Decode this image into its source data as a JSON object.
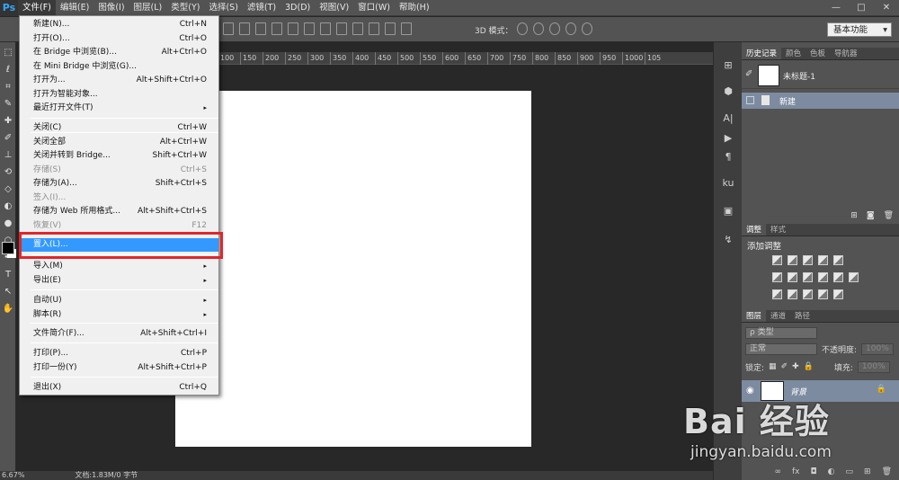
{
  "app": {
    "logo": "Ps"
  },
  "menubar": {
    "items": [
      "文件(F)",
      "编辑(E)",
      "图像(I)",
      "图层(L)",
      "类型(Y)",
      "选择(S)",
      "滤镜(T)",
      "3D(D)",
      "视图(V)",
      "窗口(W)",
      "帮助(H)"
    ],
    "active_index": 0,
    "window_controls": [
      "—",
      "□",
      "✕"
    ]
  },
  "options": {
    "mode_3d_label": "3D 模式：",
    "workspace": "基本功能"
  },
  "tools": {
    "icons": [
      "marquee-icon",
      "lasso-icon",
      "crop-icon",
      "eyedropper-icon",
      "healing-icon",
      "brush-icon",
      "stamp-icon",
      "history-brush-icon",
      "eraser-icon",
      "gradient-icon",
      "blur-icon",
      "dodge-icon",
      "pen-icon",
      "type-icon",
      "path-select-icon",
      "hand-icon"
    ],
    "glyphs": [
      "⬚",
      "ℓ",
      "⌗",
      "✎",
      "✚",
      "✐",
      "⊥",
      "⟲",
      "◇",
      "◐",
      "●",
      "○",
      "✒",
      "T",
      "↖",
      "✋"
    ],
    "fg_color": "#000000",
    "bg_color": "#ffffff"
  },
  "ruler": {
    "ticks": [
      "100",
      "150",
      "200",
      "250",
      "300",
      "350",
      "400",
      "450",
      "500",
      "550",
      "600",
      "650",
      "700",
      "750",
      "800",
      "850",
      "900",
      "950",
      "1000",
      "105"
    ]
  },
  "status": {
    "zoom": "6.67%",
    "doc": "文档:1.83M/0 字节"
  },
  "file_menu": {
    "items": [
      {
        "label": "新建(N)...",
        "shortcut": "Ctrl+N"
      },
      {
        "label": "打开(O)...",
        "shortcut": "Ctrl+O"
      },
      {
        "label": "在 Bridge 中浏览(B)...",
        "shortcut": "Alt+Ctrl+O"
      },
      {
        "label": "在 Mini Bridge 中浏览(G)...",
        "shortcut": ""
      },
      {
        "label": "打开为...",
        "shortcut": "Alt+Shift+Ctrl+O"
      },
      {
        "label": "打开为智能对象...",
        "shortcut": ""
      },
      {
        "label": "最近打开文件(T)",
        "shortcut": "▸"
      },
      {
        "label": "关闭(C)",
        "shortcut": "Ctrl+W"
      },
      {
        "label": "关闭全部",
        "shortcut": "Alt+Ctrl+W"
      },
      {
        "label": "关闭并转到 Bridge...",
        "shortcut": "Shift+Ctrl+W"
      },
      {
        "label": "存储(S)",
        "shortcut": "Ctrl+S"
      },
      {
        "label": "存储为(A)...",
        "shortcut": "Shift+Ctrl+S"
      },
      {
        "label": "签入(I)...",
        "shortcut": ""
      },
      {
        "label": "存储为 Web 所用格式...",
        "shortcut": "Alt+Shift+Ctrl+S"
      },
      {
        "label": "恢复(V)",
        "shortcut": "F12"
      },
      {
        "label": "置入(L)...",
        "shortcut": ""
      },
      {
        "label": "导入(M)",
        "shortcut": "▸"
      },
      {
        "label": "导出(E)",
        "shortcut": "▸"
      },
      {
        "label": "自动(U)",
        "shortcut": "▸"
      },
      {
        "label": "脚本(R)",
        "shortcut": "▸"
      },
      {
        "label": "文件简介(F)...",
        "shortcut": "Alt+Shift+Ctrl+I"
      },
      {
        "label": "打印(P)...",
        "shortcut": "Ctrl+P"
      },
      {
        "label": "打印一份(Y)",
        "shortcut": "Alt+Shift+Ctrl+P"
      },
      {
        "label": "退出(X)",
        "shortcut": "Ctrl+Q"
      }
    ],
    "highlight_color": "#3399ff",
    "callout_color": "#e2252b"
  },
  "dock": {
    "glyphs": [
      "⊞",
      "⬢",
      "A|",
      "▶",
      "¶",
      "ku",
      "▣",
      "↯"
    ]
  },
  "history_panel": {
    "tabs": [
      "历史记录",
      "颜色",
      "色板",
      "导航器"
    ],
    "snapshot": "未标题-1",
    "state": "新建",
    "footer_icons": [
      "⊞",
      "◙",
      "🗑"
    ]
  },
  "adjust_panel": {
    "tabs": [
      "调整",
      "样式"
    ],
    "title": "添加调整"
  },
  "layers_panel": {
    "tabs": [
      "图层",
      "通道",
      "路径"
    ],
    "filter": "ρ 类型",
    "blend": "正常",
    "opacity_label": "不透明度:",
    "opacity_value": "100%",
    "lock_label": "锁定:",
    "fill_label": "填充:",
    "fill_value": "100%",
    "layer_name": "背景",
    "footer_icons": [
      "∞",
      "fx",
      "◘",
      "◐",
      "▭",
      "⊞",
      "🗑"
    ]
  },
  "watermark": {
    "logo": "Bai 经验",
    "url": "jingyan.baidu.com"
  }
}
